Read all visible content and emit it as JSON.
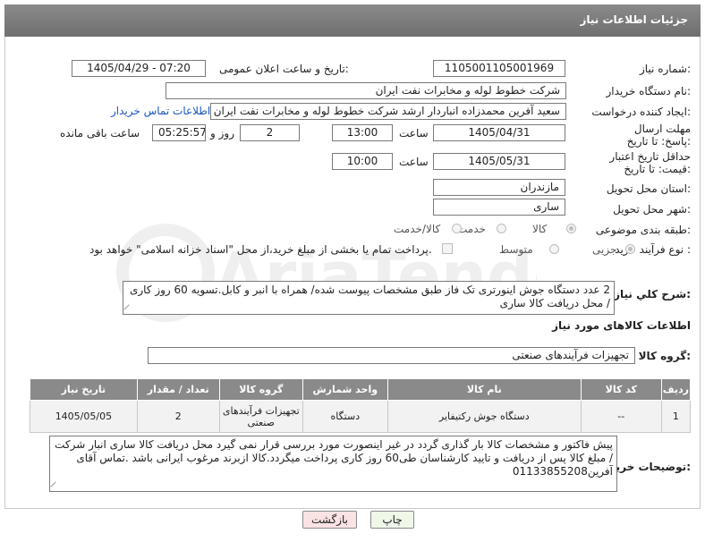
{
  "header": {
    "title": "جزئیات اطلاعات نیاز"
  },
  "labels": {
    "need_number": "شماره نیاز:",
    "announce_datetime": "تاریخ و ساعت اعلان عمومی:",
    "buyer_org": "نام دستگاه خریدار:",
    "requester": "ایجاد کننده درخواست:",
    "reply_deadline": "مهلت ارسال پاسخ: تا تاریخ:",
    "price_validity": "حداقل تاریخ اعتبار قیمت: تا تاریخ:",
    "time_word": "ساعت",
    "day_and": "روز و",
    "remaining": "ساعت باقی مانده",
    "province": "استان محل تحویل:",
    "city": "شهر محل تحویل:",
    "category": "طبقه بندی موضوعی:",
    "process_type": "نوع فرآیند خرید :",
    "general_desc": "شرح کلي نیاز:",
    "goods_info": "اطلاعات کالاهای مورد نیاز",
    "goods_group": "گروه کالا:",
    "buyer_notes": "توضیحات خریدار:"
  },
  "values": {
    "need_number": "1105001105001969",
    "announce_datetime": "1405/04/29 - 07:20",
    "buyer_org": "شرکت خطوط لوله و مخابرات نفت ایران",
    "requester": "سعید آفرین محمدزاده انباردار ارشد شرکت خطوط لوله و مخابرات نفت ایران",
    "contact_link": "اطلاعات تماس خریدار",
    "reply_date": "1405/04/31",
    "reply_time": "13:00",
    "reply_days": "2",
    "reply_remaining": "05:25:57",
    "price_date": "1405/05/31",
    "price_time": "10:00",
    "province": "مازندران",
    "city": "ساری",
    "general_desc": "2 عدد دستگاه جوش اینورتری تک فاز طبق مشخصات پیوست شده/ همراه با انبر و کابل.تسویه 60 روز کاری / محل دریافت کالا ساری",
    "goods_group": "تجهیزات فرآیندهای صنعتی",
    "buyer_notes": "پیش فاکتور و مشخصات کالا بار گذاری گردد در غیر اینصورت مورد بررسی قرار نمی گیرد محل دریافت کالا ساری انبار شرکت / مبلغ کالا پس از دریافت و تایید کارشناسان طی60 روز کاری پرداخت میگردد.کالا ازبرند مرغوب ایرانی باشد .تماس آقای آفرین01133855208"
  },
  "category_options": [
    {
      "label": "کالا",
      "selected": true
    },
    {
      "label": "خدمت",
      "selected": false
    },
    {
      "label": "کالا/خدمت",
      "selected": false
    }
  ],
  "process_options": [
    {
      "label": "جزیی",
      "selected": true
    },
    {
      "label": "متوسط",
      "selected": false
    }
  ],
  "process_note": "پرداخت تمام یا بخشی از مبلغ خرید،از محل \"اسناد خزانه اسلامی\" خواهد بود.",
  "table": {
    "headers": [
      "ردیف",
      "کد کالا",
      "نام کالا",
      "واحد شمارش",
      "گروه کالا",
      "تعداد / مقدار",
      "تاریخ نیاز"
    ],
    "rows": [
      [
        "1",
        "--",
        "دستگاه جوش رکتیفایر",
        "دستگاه",
        "تجهیزات فرآیندهای صنعتی",
        "2",
        "1405/05/05"
      ]
    ]
  },
  "buttons": {
    "print": "چاپ",
    "back": "بازگشت"
  },
  "watermark": "AriaTender.net"
}
